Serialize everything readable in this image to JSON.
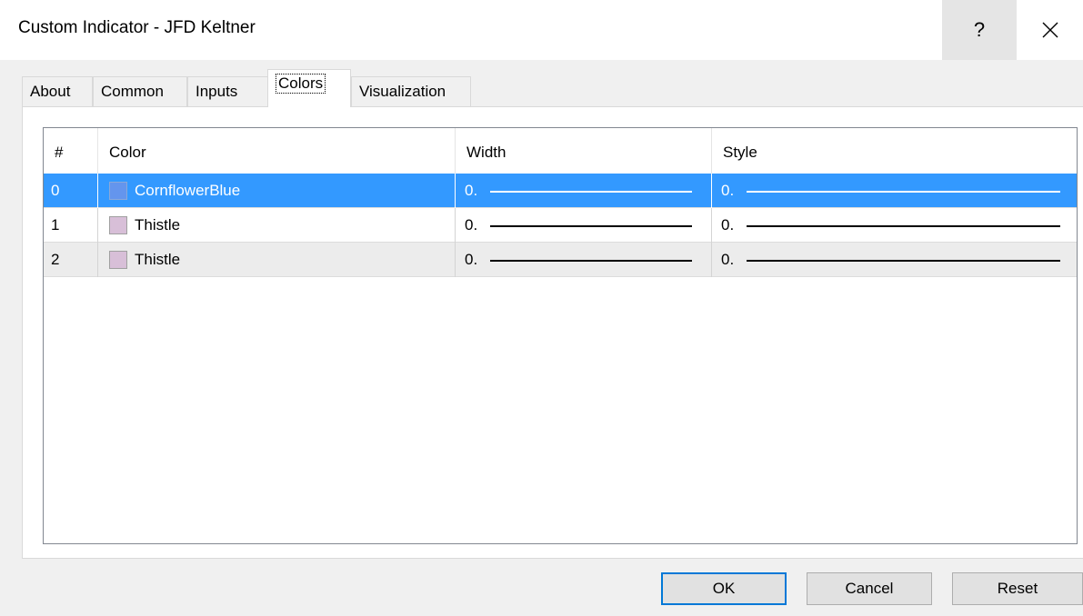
{
  "window": {
    "title": "Custom Indicator - JFD Keltner",
    "help_label": "?"
  },
  "tabs": [
    {
      "label": "About",
      "active": false
    },
    {
      "label": "Common",
      "active": false
    },
    {
      "label": "Inputs",
      "active": false
    },
    {
      "label": "Colors",
      "active": true
    },
    {
      "label": "Visualization",
      "active": false
    }
  ],
  "table": {
    "columns": [
      "#",
      "Color",
      "Width",
      "Style"
    ],
    "rows": [
      {
        "index": "0",
        "color_name": "CornflowerBlue",
        "swatch": "#6495ed",
        "width": "0.",
        "style": "0.",
        "selected": true
      },
      {
        "index": "1",
        "color_name": "Thistle",
        "swatch": "#d8bfd8",
        "width": "0.",
        "style": "0.",
        "selected": false
      },
      {
        "index": "2",
        "color_name": "Thistle",
        "swatch": "#d8bfd8",
        "width": "0.",
        "style": "0.",
        "selected": false
      }
    ]
  },
  "buttons": {
    "ok": "OK",
    "cancel": "Cancel",
    "reset": "Reset"
  },
  "colors": {
    "selection": "#3399ff",
    "default_button_border": "#0078d7"
  }
}
